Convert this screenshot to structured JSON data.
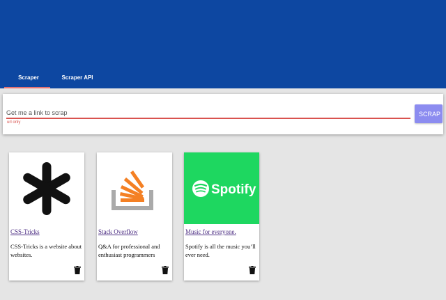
{
  "tabs": [
    {
      "label": "Scraper"
    },
    {
      "label": "Scraper API"
    }
  ],
  "search": {
    "placeholder": "Get me a link to scrap",
    "hint": "url only",
    "button_label": "SCRAP"
  },
  "cards": [
    {
      "title": "CSS-Tricks",
      "description": "CSS-Tricks is a website about websites.",
      "icon": "asterisk-logo-icon"
    },
    {
      "title": "Stack Overflow",
      "description": "Q&A for professional and enthusiast programmers",
      "icon": "stackoverflow-logo-icon"
    },
    {
      "title": "Music for everyone.",
      "description": "Spotify is all the music you’ll ever need.",
      "icon": "spotify-logo-icon",
      "logo_text": "Spotify"
    }
  ],
  "colors": {
    "header": "#0d47a1",
    "tab_indicator": "#e57373",
    "input_underline": "#d9534f",
    "scrap_button": "#8c8cf0",
    "spotify_green": "#1ed760"
  }
}
